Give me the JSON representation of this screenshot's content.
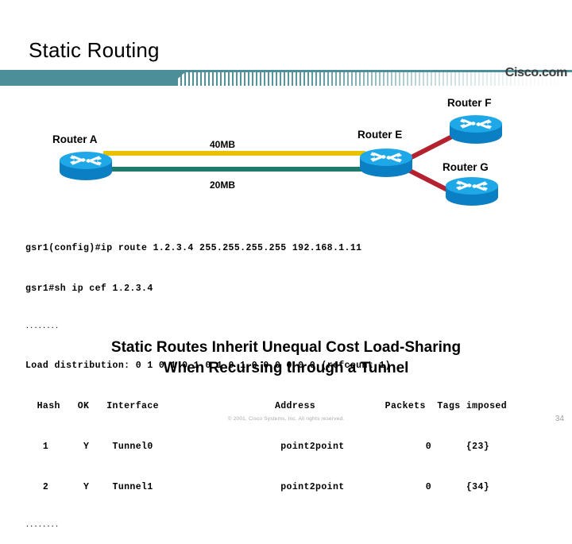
{
  "slide": {
    "title": "Static Routing",
    "brand": "Cisco.com"
  },
  "diagram": {
    "nodes": [
      {
        "id": "router-a",
        "label": "Router A"
      },
      {
        "id": "router-e",
        "label": "Router E"
      },
      {
        "id": "router-f",
        "label": "Router F"
      },
      {
        "id": "router-g",
        "label": "Router G"
      }
    ],
    "links": [
      {
        "id": "a-e-upper",
        "label": "40MB",
        "color": "#e8c200",
        "from": "router-a",
        "to": "router-e"
      },
      {
        "id": "a-e-lower",
        "label": "20MB",
        "color": "#1e7a6a",
        "from": "router-a",
        "to": "router-e"
      },
      {
        "id": "e-f",
        "label": "",
        "color": "#b5222f",
        "from": "router-e",
        "to": "router-f"
      },
      {
        "id": "e-g",
        "label": "",
        "color": "#b5222f",
        "from": "router-e",
        "to": "router-g"
      }
    ]
  },
  "console": {
    "line1": "gsr1(config)#ip route 1.2.3.4 255.255.255.255 192.168.1.11",
    "line2": "gsr1#sh ip cef 1.2.3.4",
    "ellipsis1": "........",
    "line3": "Load distribution: 0 1 0 1 0 1 0 1 0 1 0 0 0 0 0 0 (refcount 1)",
    "table_header": "  Hash   OK   Interface                    Address            Packets  Tags imposed",
    "rows": [
      "   1      Y    Tunnel0                      point2point              0      {23}",
      "   2      Y    Tunnel1                      point2point              0      {34}"
    ],
    "ellipsis2": "........"
  },
  "caption": {
    "line1": "Static Routes Inherit Unequal Cost Load-Sharing",
    "line2": "When Recursing through a Tunnel"
  },
  "footer": {
    "copyright": "© 2001, Cisco Systems, Inc. All rights reserved.",
    "page_number": "34"
  }
}
